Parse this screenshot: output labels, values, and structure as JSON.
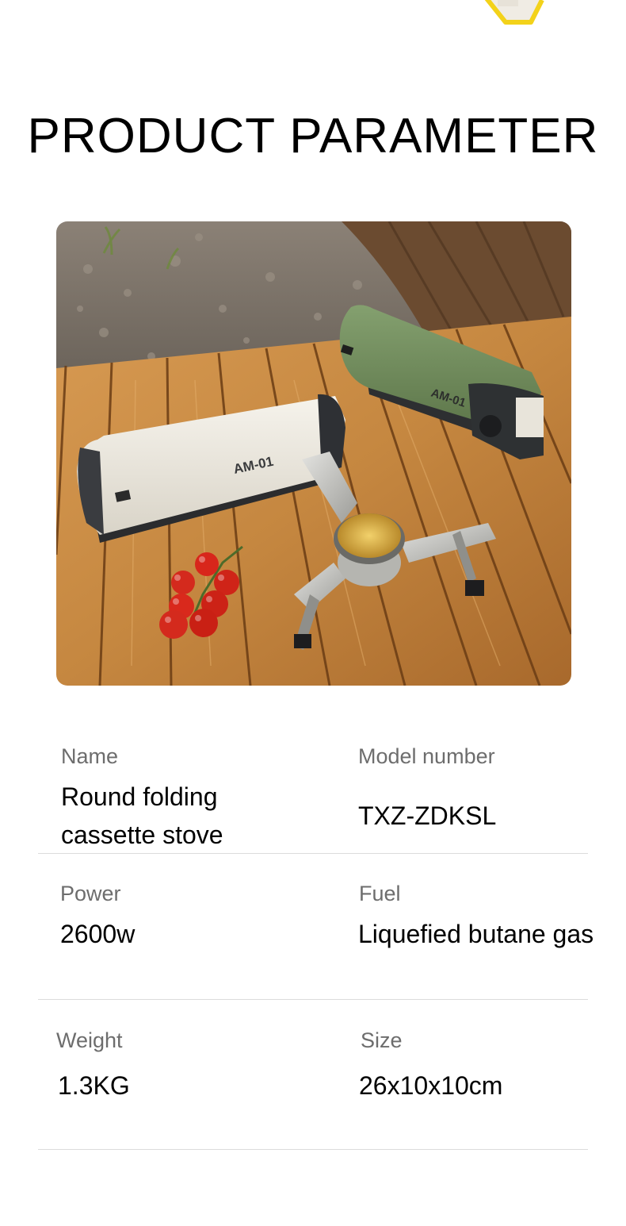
{
  "page": {
    "title": "PRODUCT PARAMETER"
  },
  "photo": {
    "product_label_front": "AM-01",
    "product_label_back": "AM-01",
    "colors": {
      "front_body": "#ece8df",
      "back_body": "#6f8a5b",
      "table_wood": "#c88a43",
      "tomato": "#d8261b"
    }
  },
  "specs": [
    {
      "label": "Name",
      "value": "Round folding cassette stove"
    },
    {
      "label": "Model number",
      "value": "TXZ-ZDKSL"
    },
    {
      "label": "Power",
      "value": "2600w"
    },
    {
      "label": "Fuel",
      "value": "Liquefied butane gas"
    },
    {
      "label": "Weight",
      "value": "1.3KG"
    },
    {
      "label": "Size",
      "value": "26x10x10cm"
    }
  ]
}
